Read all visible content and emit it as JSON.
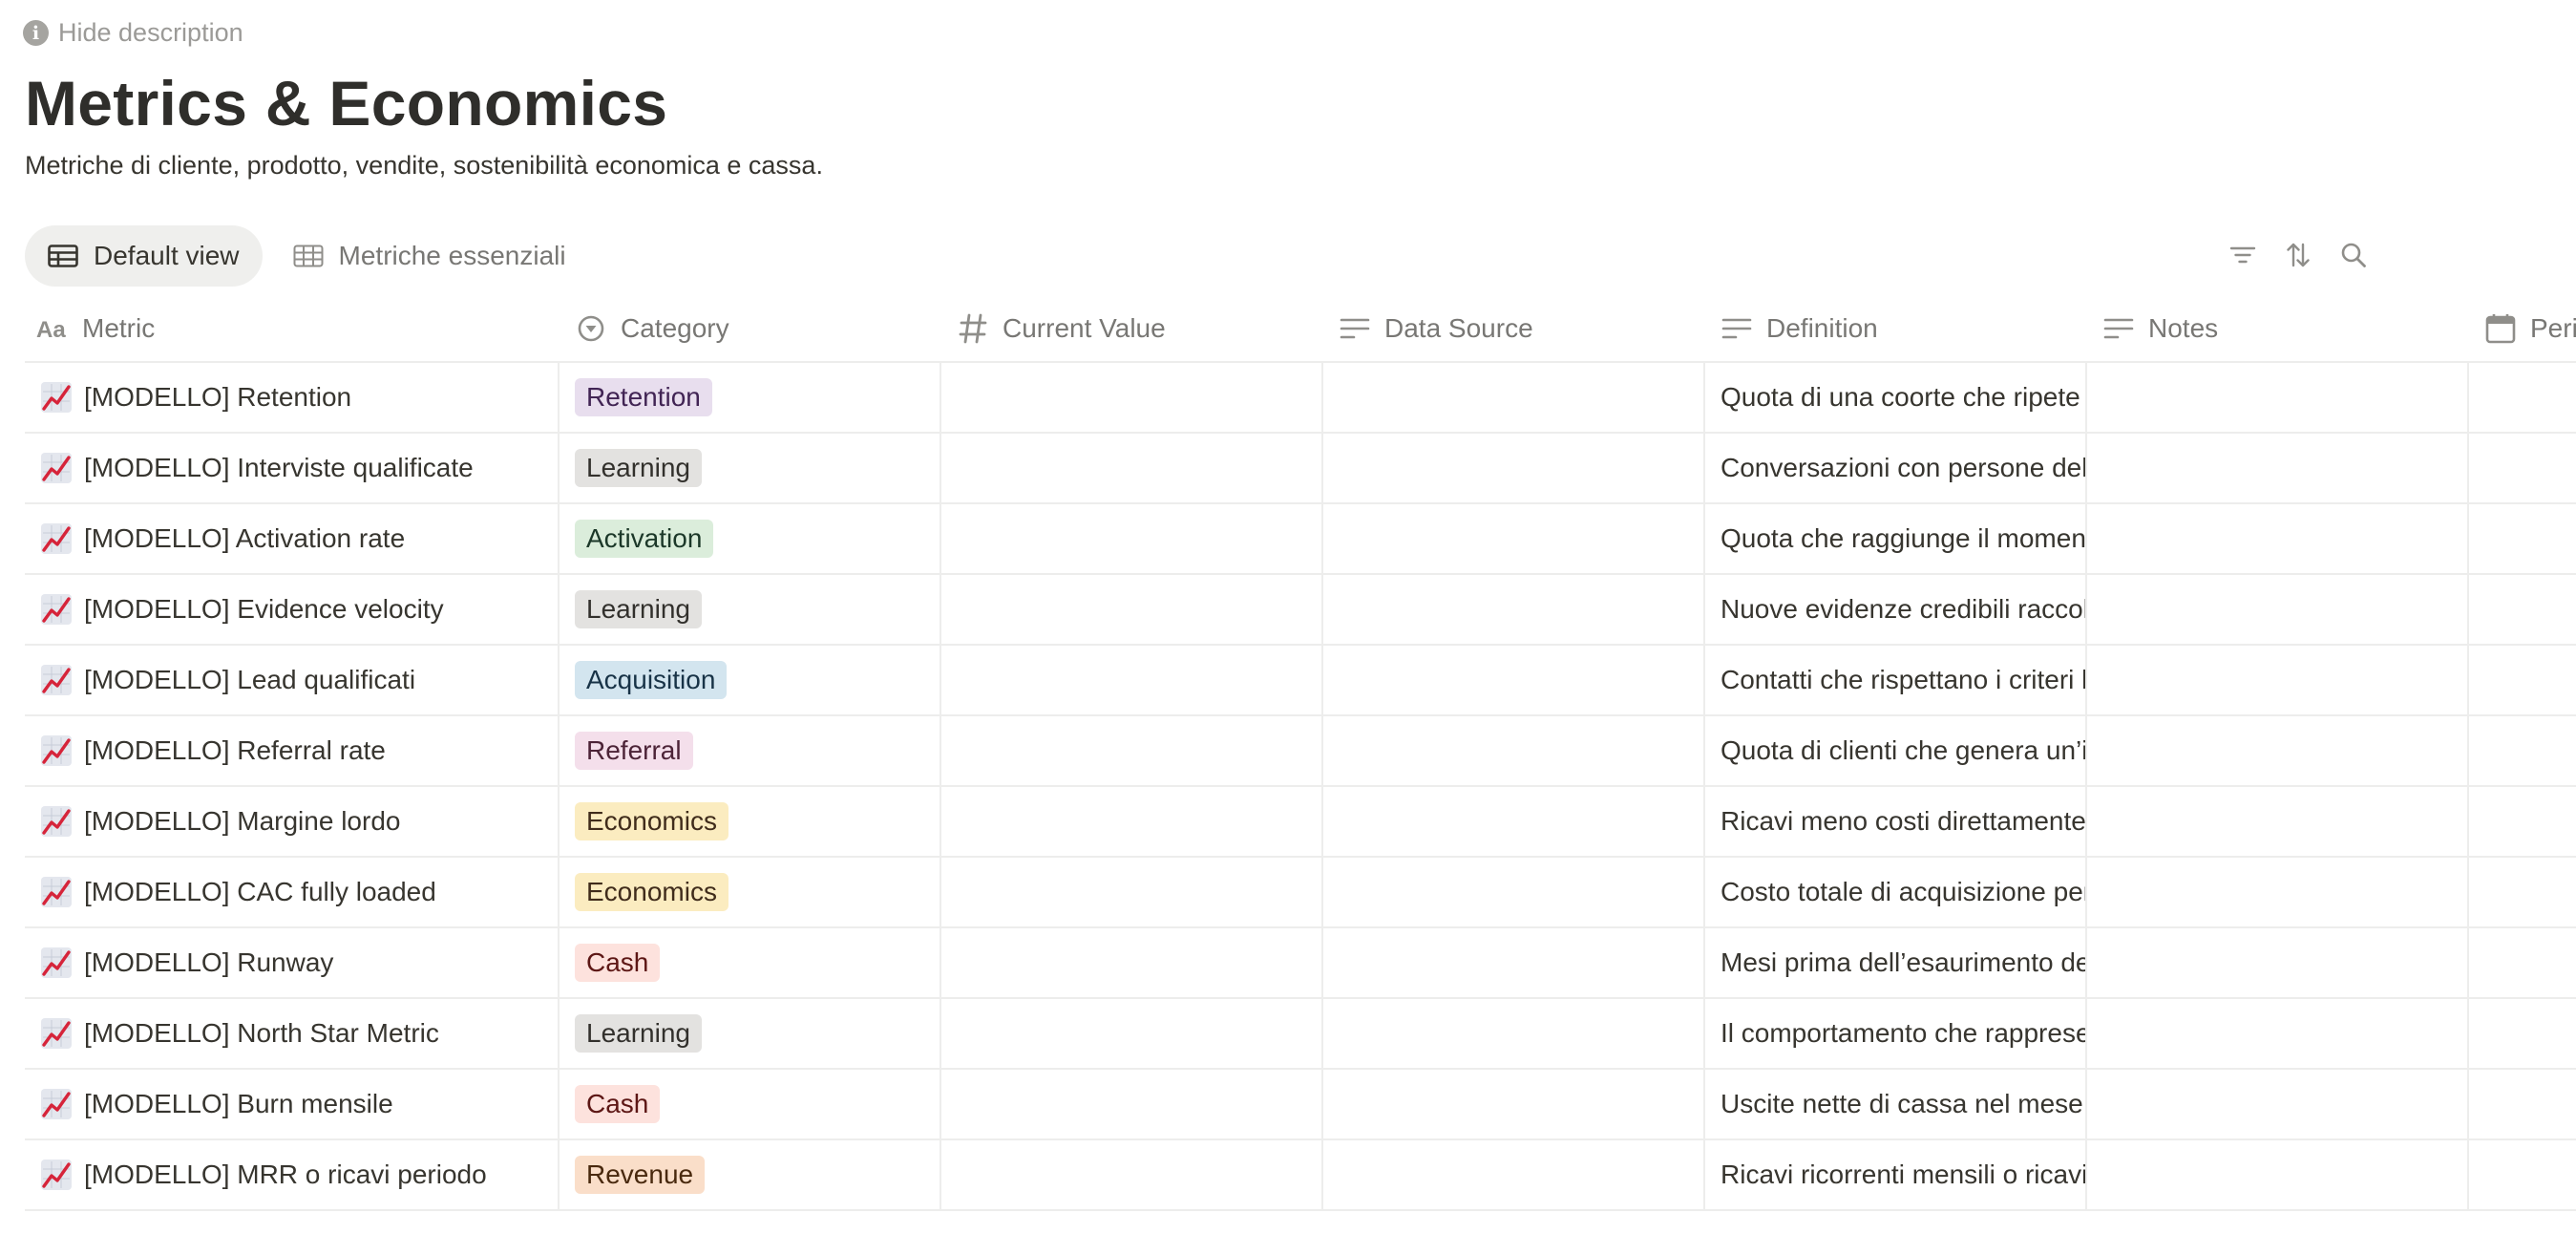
{
  "header": {
    "hide_description": "Hide description",
    "title": "Metrics & Economics",
    "subtitle": "Metriche di cliente, prodotto, vendite, sostenibilità economica e cassa."
  },
  "tabs": [
    {
      "label": "Default view",
      "active": true
    },
    {
      "label": "Metriche essenziali",
      "active": false
    }
  ],
  "toolbar": {
    "icons": [
      "filter-icon",
      "sort-icon",
      "search-icon"
    ]
  },
  "columns": [
    "Metric",
    "Category",
    "Current Value",
    "Data Source",
    "Definition",
    "Notes",
    "Peri"
  ],
  "rows": [
    {
      "metric": "[MODELLO] Retention",
      "category": "Retention",
      "tag": "retention",
      "definition": "Quota di una coorte che ripete"
    },
    {
      "metric": "[MODELLO] Interviste qualificate",
      "category": "Learning",
      "tag": "learning",
      "definition": "Conversazioni con persone del"
    },
    {
      "metric": "[MODELLO] Activation rate",
      "category": "Activation",
      "tag": "activation",
      "definition": "Quota che raggiunge il moment"
    },
    {
      "metric": "[MODELLO] Evidence velocity",
      "category": "Learning",
      "tag": "learning",
      "definition": "Nuove evidenze credibili raccol"
    },
    {
      "metric": "[MODELLO] Lead qualificati",
      "category": "Acquisition",
      "tag": "acquisition",
      "definition": "Contatti che rispettano i criteri l"
    },
    {
      "metric": "[MODELLO] Referral rate",
      "category": "Referral",
      "tag": "referral",
      "definition": "Quota di clienti che genera un’i"
    },
    {
      "metric": "[MODELLO] Margine lordo",
      "category": "Economics",
      "tag": "economics",
      "definition": "Ricavi meno costi direttamente"
    },
    {
      "metric": "[MODELLO] CAC fully loaded",
      "category": "Economics",
      "tag": "economics",
      "definition": "Costo totale di acquisizione per"
    },
    {
      "metric": "[MODELLO] Runway",
      "category": "Cash",
      "tag": "cash",
      "definition": "Mesi prima dell’esaurimento de"
    },
    {
      "metric": "[MODELLO] North Star Metric",
      "category": "Learning",
      "tag": "learning",
      "definition": "Il comportamento che rapprese"
    },
    {
      "metric": "[MODELLO] Burn mensile",
      "category": "Cash",
      "tag": "cash",
      "definition": "Uscite nette di cassa nel mese"
    },
    {
      "metric": "[MODELLO] MRR o ricavi periodo",
      "category": "Revenue",
      "tag": "revenue",
      "definition": "Ricavi ricorrenti mensili o ricavi"
    }
  ]
}
